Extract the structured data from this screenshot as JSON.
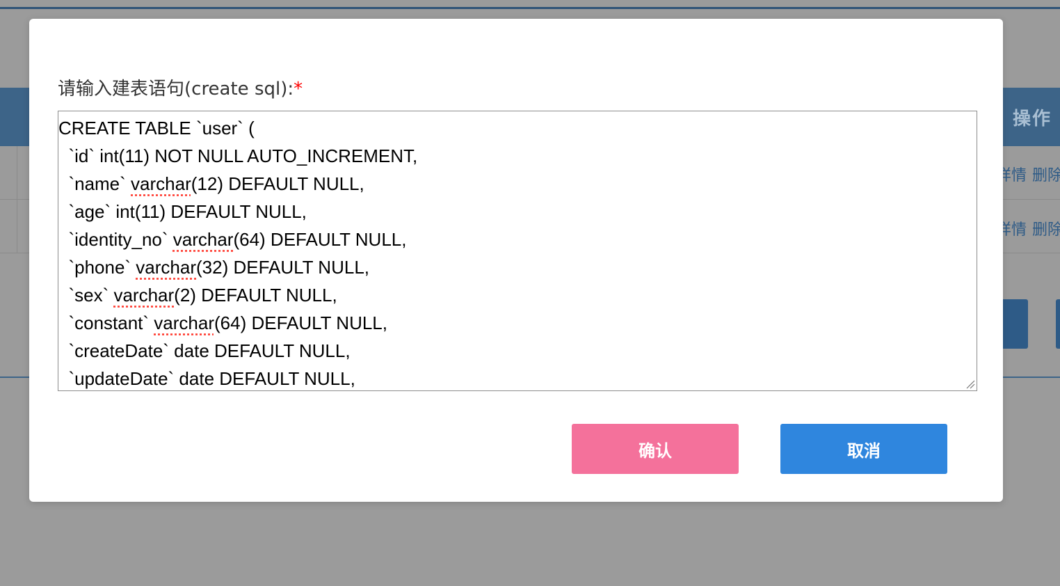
{
  "background": {
    "header_label": "操作",
    "rows": [
      {
        "detail": "详情",
        "delete": "删除"
      },
      {
        "detail": "详情",
        "delete": "删除"
      }
    ]
  },
  "modal": {
    "label": "请输入建表语句(create sql):",
    "required_mark": "*",
    "sql_lines": [
      "CREATE TABLE `user` (",
      "  `id` int(11) NOT NULL AUTO_INCREMENT,",
      "  `name` varchar(12) DEFAULT NULL,",
      "  `age` int(11) DEFAULT NULL,",
      "  `identity_no` varchar(64) DEFAULT NULL,",
      "  `phone` varchar(32) DEFAULT NULL,",
      "  `sex` varchar(2) DEFAULT NULL,",
      "  `constant` varchar(64) DEFAULT NULL,",
      "  `createDate` date DEFAULT NULL,",
      "  `updateDate` date DEFAULT NULL,"
    ],
    "confirm_label": "确认",
    "cancel_label": "取消"
  },
  "colors": {
    "confirm": "#f4719b",
    "cancel": "#2f86de",
    "overlay": "#9b9b9b",
    "required": "#ff0000"
  }
}
